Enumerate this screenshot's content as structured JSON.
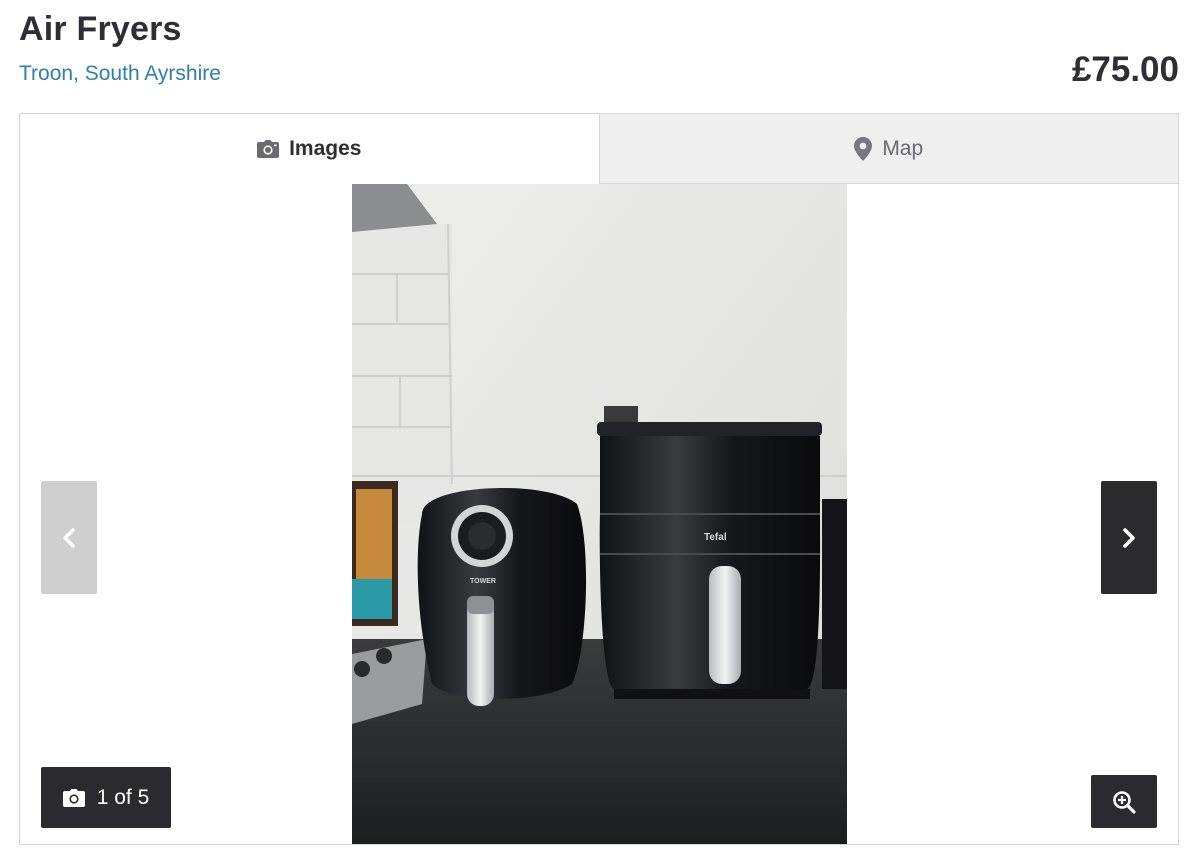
{
  "listing": {
    "title": "Air Fryers",
    "location": "Troon, South Ayrshire",
    "price": "£75.00"
  },
  "tabs": [
    {
      "label": "Images",
      "icon": "camera-icon",
      "active": true
    },
    {
      "label": "Map",
      "icon": "map-pin-icon",
      "active": false
    }
  ],
  "gallery": {
    "counter": "1 of 5",
    "current_image": 1,
    "total_images": 5
  },
  "photo": {
    "brand_left": "TOWER",
    "brand_right": "Tefal"
  },
  "colors": {
    "link": "#2f7fa8",
    "text": "#2f2e36",
    "dark_button": "#2b2b2f",
    "disabled_button": "#cfcfcf",
    "inactive_tab": "#efefef"
  }
}
